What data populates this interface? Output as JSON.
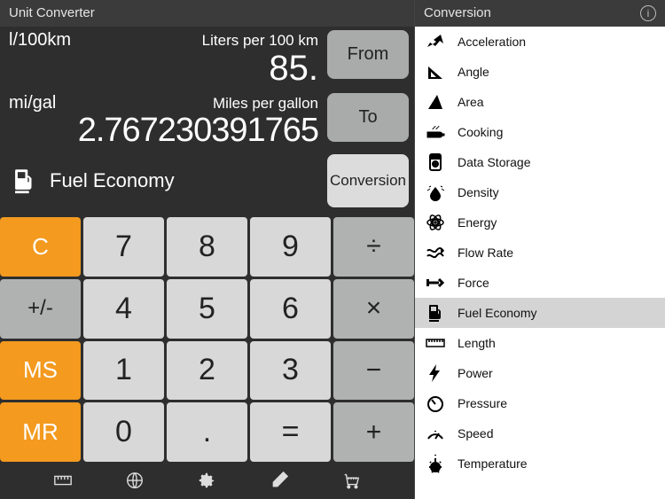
{
  "header": {
    "left_title": "Unit Converter",
    "right_title": "Conversion"
  },
  "display": {
    "from": {
      "short": "l/100km",
      "long": "Liters per 100 km",
      "value": "85."
    },
    "to": {
      "short": "mi/gal",
      "long": "Miles per gallon",
      "value": "2.767230391765"
    },
    "from_button": "From",
    "to_button": "To",
    "conversion_button": "Conversion",
    "category": "Fuel Economy"
  },
  "keypad": {
    "c": "C",
    "k7": "7",
    "k8": "8",
    "k9": "9",
    "div": "÷",
    "pm": "+/-",
    "k4": "4",
    "k5": "5",
    "k6": "6",
    "mul": "×",
    "ms": "MS",
    "k1": "1",
    "k2": "2",
    "k3": "3",
    "sub": "−",
    "mr": "MR",
    "k0": "0",
    "dot": ".",
    "eq": "=",
    "add": "+"
  },
  "categories": [
    {
      "label": "Acceleration",
      "selected": false
    },
    {
      "label": "Angle",
      "selected": false
    },
    {
      "label": "Area",
      "selected": false
    },
    {
      "label": "Cooking",
      "selected": false
    },
    {
      "label": "Data Storage",
      "selected": false
    },
    {
      "label": "Density",
      "selected": false
    },
    {
      "label": "Energy",
      "selected": false
    },
    {
      "label": "Flow Rate",
      "selected": false
    },
    {
      "label": "Force",
      "selected": false
    },
    {
      "label": "Fuel Economy",
      "selected": true
    },
    {
      "label": "Length",
      "selected": false
    },
    {
      "label": "Power",
      "selected": false
    },
    {
      "label": "Pressure",
      "selected": false
    },
    {
      "label": "Speed",
      "selected": false
    },
    {
      "label": "Temperature",
      "selected": false
    }
  ]
}
